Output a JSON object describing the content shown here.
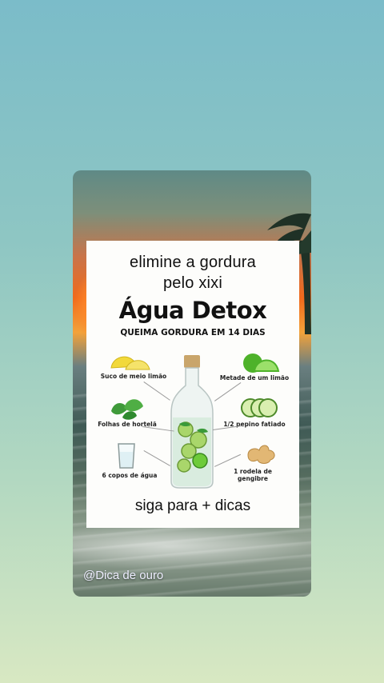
{
  "poster": {
    "headline_line1": "elimine a gordura",
    "headline_line2": "pelo xixi",
    "title": "Água Detox",
    "subtitle": "QUEIMA GORDURA EM 14 DIAS",
    "footer": "siga para + dicas"
  },
  "ingredients": {
    "lemon_juice": "Suco de meio limão",
    "mint": "Folhas de hortelã",
    "water": "6 copos de água",
    "half_lime": "Metade de um limão",
    "cucumber": "1/2 pepino fatiado",
    "ginger_line1": "1 rodela de",
    "ginger_line2": "gengibre"
  },
  "handle": "@Dica de ouro",
  "colors": {
    "lemon": "#f2d93a",
    "lime": "#6ecb3a",
    "cucumber": "#a9d66b",
    "ginger": "#e2b774"
  }
}
